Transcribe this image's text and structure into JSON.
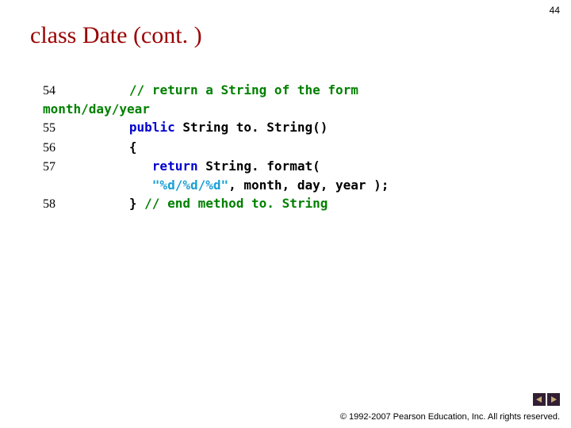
{
  "page_number": "44",
  "title": "class Date (cont. )",
  "code": {
    "line54_no": "54",
    "line54_comment": "// return a String of the form",
    "wrap_comment": "month/day/year",
    "line55_no": "55",
    "line55_kw": "public",
    "line55_rest": " String to. String()",
    "line56_no": "56",
    "line56_text": "{",
    "line57_no": "57",
    "line57_kw": "return",
    "line57_rest": " String. format(",
    "line57b_str": "\"%d/%d/%d\"",
    "line57b_rest": ", month, day, year );",
    "line58_no": "58",
    "line58_brace": "} ",
    "line58_comment": "// end method to. String"
  },
  "nav": {
    "prev": "prev-slide",
    "next": "next-slide"
  },
  "copyright": "© 1992-2007 Pearson Education, Inc.  All rights reserved."
}
